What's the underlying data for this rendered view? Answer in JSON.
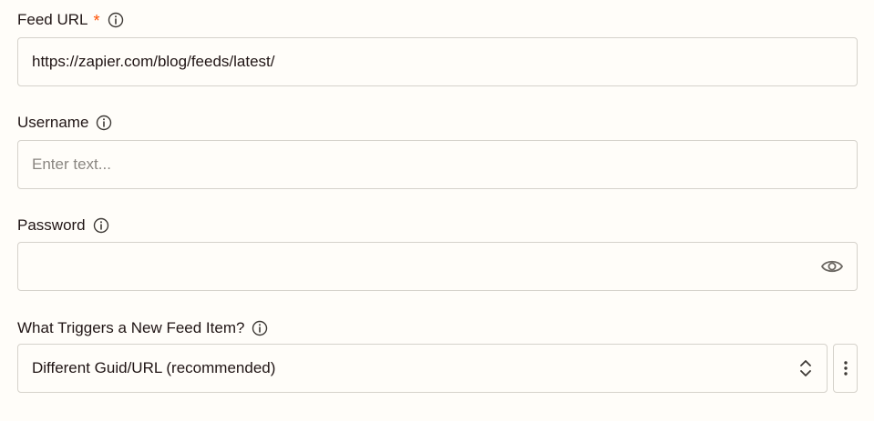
{
  "fields": {
    "feed_url": {
      "label": "Feed URL",
      "required_mark": "*",
      "value": "https://zapier.com/blog/feeds/latest/"
    },
    "username": {
      "label": "Username",
      "placeholder": "Enter text..."
    },
    "password": {
      "label": "Password",
      "value": ""
    },
    "trigger": {
      "label": "What Triggers a New Feed Item?",
      "selected": "Different Guid/URL (recommended)"
    }
  },
  "icons": {
    "info": "info-icon",
    "eye": "eye-icon",
    "updown": "chevron-up-down-icon",
    "more": "kebab-menu-icon"
  },
  "colors": {
    "background": "#fffdf9",
    "text": "#201515",
    "required": "#ff4f00",
    "border": "#d5d2cb",
    "placeholder": "#8a8681"
  }
}
